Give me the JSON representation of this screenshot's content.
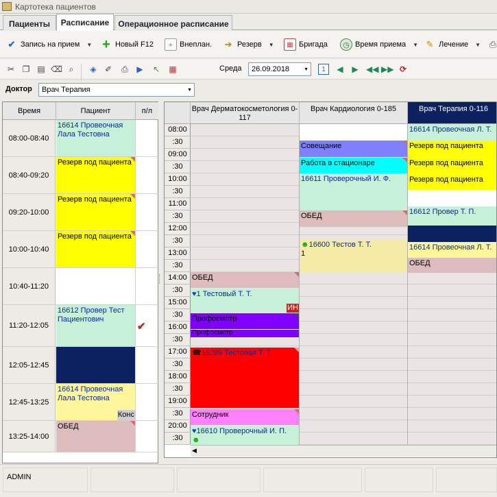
{
  "window": {
    "title": "Картотека пациентов"
  },
  "tabs": [
    {
      "label": "Пациенты"
    },
    {
      "label": "Расписание"
    },
    {
      "label": "Операционное расписание"
    }
  ],
  "toolbar": {
    "appointment": "Запись на прием",
    "new": "Новый F12",
    "unplanned": "Внеплан.",
    "reserve": "Резерв",
    "team": "Бригада",
    "reception_time": "Время приема",
    "treatment": "Лечение"
  },
  "toolbar2": {
    "day_label": "Среда",
    "date": "26.09.2018"
  },
  "doctor": {
    "label": "Доктор",
    "value": "Врач Терапия"
  },
  "left": {
    "headers": {
      "time": "Время",
      "patient": "Пациент",
      "pp": "п/л"
    },
    "rows": [
      {
        "time": "08:00-08:40",
        "text": "16614 Провеочная Лала Тестовна",
        "color": "#c6f0d8",
        "tcolor": "#0a2a9a",
        "corner": false,
        "note": ""
      },
      {
        "time": "08:40-09:20",
        "text": "Резерв под пациента",
        "color": "#ffff00",
        "tcolor": "#000",
        "corner": true,
        "note": ""
      },
      {
        "time": "09:20-10:00",
        "text": "Резерв под пациента",
        "color": "#ffff00",
        "tcolor": "#000",
        "corner": true,
        "note": ""
      },
      {
        "time": "10:00-10:40",
        "text": "Резерв под пациента",
        "color": "#ffff00",
        "tcolor": "#000",
        "corner": true,
        "note": ""
      },
      {
        "time": "10:40-11:20",
        "text": "",
        "color": "#ffffff",
        "tcolor": "#000",
        "corner": false,
        "note": ""
      },
      {
        "time": "11:20-12:05",
        "text": "16612 Провер Тест Пациентович",
        "color": "#c6f0d8",
        "tcolor": "#0a2a9a",
        "corner": false,
        "note": ""
      },
      {
        "time": "12:05-12:45",
        "text": "",
        "color": "#0c2160",
        "tcolor": "#fff",
        "corner": false,
        "note": ""
      },
      {
        "time": "12:45-13:25",
        "text": "16614 Провеочная Лала Тестовна",
        "color": "#fff59a",
        "tcolor": "#0a2a9a",
        "corner": false,
        "note": "Конс"
      },
      {
        "time": "13:25-14:00",
        "text": "ОБЕД",
        "color": "#dcbcbc",
        "tcolor": "#000",
        "corner": true,
        "note": ""
      }
    ]
  },
  "right": {
    "columns": [
      {
        "title": "Врач Дерматокосметология 0-117"
      },
      {
        "title": "Врач Кардиология  0-185"
      },
      {
        "title": "Врач Терапия  0-116"
      }
    ],
    "times": [
      "08:00",
      ":30",
      "09:00",
      ":30",
      "10:00",
      ":30",
      "11:00",
      ":30",
      "12:00",
      ":30",
      "13:00",
      ":30",
      "14:00",
      ":30",
      "15:00",
      ":30",
      "16:00",
      ":30",
      "17:00",
      ":30",
      "18:00",
      ":30",
      "19:00",
      ":30",
      "20:00",
      ":30"
    ],
    "col1_events": {
      "lunch": "ОБЕД",
      "e1": "1 Тестовый  Т. Т.",
      "e1_tag": "ИН",
      "e2": "Профосмотр",
      "e3": "Профосмотр",
      "e4": "16289 Тестовая  Т. Т.",
      "e5": "Сотрудник",
      "e6": "16610 Проверочный  И. П."
    },
    "col2_events": {
      "e1": "Совещание",
      "e2": "Работа в стационаре",
      "e3": "16611 Проверочный  И. Ф.",
      "e4": "ОБЕД",
      "e5": "16600 Тестов  Т. Т.",
      "e5_sub": "1"
    },
    "col3_events": {
      "e1": "16614 Провеочная  Л. Т.",
      "e2": "Резерв под пациента",
      "e3": "Резерв под пациента",
      "e4": "Резерв под пациента",
      "e5": "16612 Провер  Т. П.",
      "e6": "16614 Провеочная  Л. Т.",
      "e7": "ОБЕД"
    }
  },
  "status": {
    "user": "ADMIN"
  }
}
